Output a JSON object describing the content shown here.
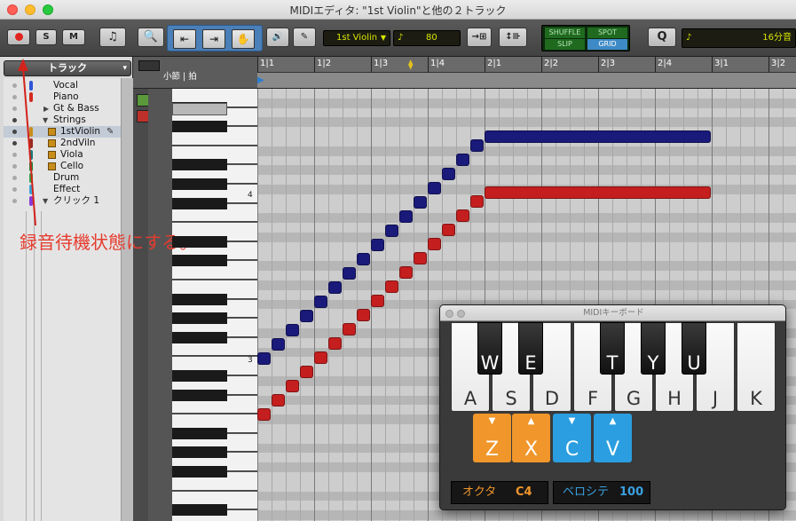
{
  "window": {
    "title": "MIDIエディタ: \"1st Violin\"と他の２トラック"
  },
  "toolbar": {
    "record_icon": "record-dot",
    "solo_label": "S",
    "mute_label": "M",
    "track_select": "1st Violin",
    "velocity": "80",
    "mode_shuffle": "SHUFFLE",
    "mode_spot": "SPOT",
    "mode_slip": "SLIP",
    "mode_grid": "GRID",
    "quantize_label": "Q",
    "grid_value": "16分音"
  },
  "tracks_panel": {
    "header": "トラック",
    "items": [
      {
        "name": "Vocal",
        "color": "#2e55d6"
      },
      {
        "name": "Piano",
        "color": "#d42a1e"
      },
      {
        "name": "Gt & Bass",
        "color": ""
      },
      {
        "name": "Strings",
        "color": ""
      },
      {
        "name": "1stViolin",
        "color": "#c98e1a"
      },
      {
        "name": "2ndViln",
        "color": "#9a2a20"
      },
      {
        "name": "Viola",
        "color": "#1a7a7a"
      },
      {
        "name": "Cello",
        "color": "#1a8a3a"
      },
      {
        "name": "Drum",
        "color": "#2aa54a"
      },
      {
        "name": "Effect",
        "color": "#3aa0d6"
      },
      {
        "name": "クリック 1",
        "color": "#8a3ad6"
      }
    ]
  },
  "ruler": {
    "left_label": "小節 | 拍",
    "ticks": [
      "1|1",
      "1|2",
      "1|3",
      "1|4",
      "2|1",
      "2|2",
      "2|3",
      "2|4",
      "3|1",
      "3|2"
    ]
  },
  "piano_labels": {
    "c4": "4",
    "c3": "3"
  },
  "annotation": "録音待機状態にする。",
  "midi_keyboard": {
    "title": "MIDIキーボード",
    "white_keys": [
      "A",
      "S",
      "D",
      "F",
      "G",
      "H",
      "J",
      "K"
    ],
    "black_keys": [
      "W",
      "E",
      "T",
      "Y",
      "U"
    ],
    "controls": [
      "Z",
      "X",
      "C",
      "V"
    ],
    "octave_label": "オクタ",
    "octave_value": "C4",
    "velocity_label": "ベロシテ",
    "velocity_value": "100"
  },
  "colors": {
    "note_blue": "#1a1a7a",
    "note_red": "#c41e1e",
    "annotation_red": "#e63b2e",
    "control_orange": "#f0962a",
    "control_blue": "#2a9ee0"
  }
}
